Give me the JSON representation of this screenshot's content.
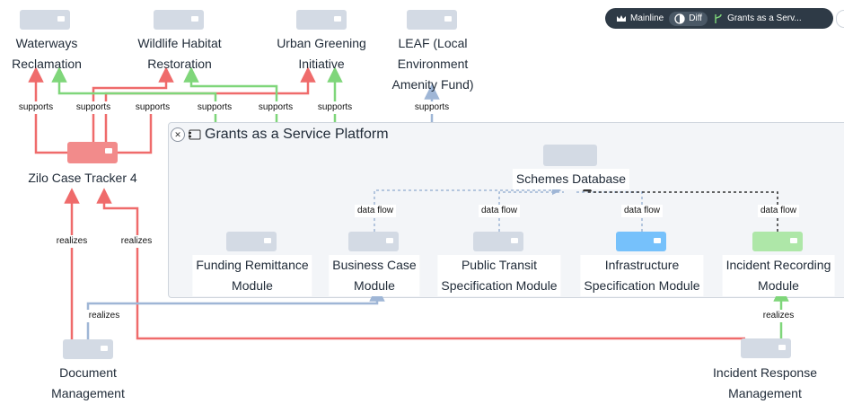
{
  "toolbar": {
    "mainline": "Mainline",
    "diff": "Diff",
    "branch": "Grants as a Serv..."
  },
  "group": {
    "title": "Grants as a Service Platform"
  },
  "nodes": {
    "waterways": [
      "Waterways",
      "Reclamation"
    ],
    "wildlife": [
      "Wildlife Habitat",
      "Restoration"
    ],
    "urban": [
      "Urban Greening",
      "Initiative"
    ],
    "leaf": [
      "LEAF (Local",
      "Environment",
      "Amenity Fund)"
    ],
    "zilo": "Zilo Case Tracker 4",
    "schemes": "Schemes Database",
    "funding": [
      "Funding Remittance",
      "Module"
    ],
    "business": [
      "Business Case",
      "Module"
    ],
    "transit": [
      "Public Transit",
      "Specification Module"
    ],
    "infra": [
      "Infrastructure",
      "Specification Module"
    ],
    "incidentRec": [
      "Incident Recording",
      "Module"
    ],
    "docMgmt": [
      "Document",
      "Management"
    ],
    "incidentResp": [
      "Incident Response",
      "Management"
    ]
  },
  "edges": {
    "supports": "supports",
    "realizes": "realizes",
    "dataflow": "data flow"
  },
  "colors": {
    "added": "#7fd67a",
    "removed": "#ef6b6b",
    "neutral": "#9fb6d6",
    "dark": "#333333"
  }
}
